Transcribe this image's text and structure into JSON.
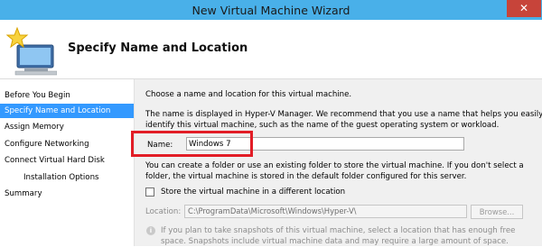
{
  "window": {
    "title": "New Virtual Machine Wizard",
    "close_label": "✕"
  },
  "header": {
    "heading": "Specify Name and Location",
    "icon": "computer-star-icon"
  },
  "sidebar": {
    "items": [
      {
        "label": "Before You Begin"
      },
      {
        "label": "Specify Name and Location"
      },
      {
        "label": "Assign Memory"
      },
      {
        "label": "Configure Networking"
      },
      {
        "label": "Connect Virtual Hard Disk"
      },
      {
        "label": "Installation Options"
      },
      {
        "label": "Summary"
      }
    ],
    "selected_index": 1
  },
  "main": {
    "intro": "Choose a name and location for this virtual machine.",
    "description_line1": "The name is displayed in Hyper-V Manager. We recommend that you use a name that helps you easily",
    "description_line2": "identify this virtual machine, such as the name of the guest operating system or workload.",
    "name_label": "Name:",
    "name_value": "Windows 7",
    "folder_line1": "You can create a folder or use an existing folder to store the virtual machine. If you don't select a",
    "folder_line2": "folder, the virtual machine is stored in the default folder configured for this server.",
    "store_checkbox_label": "Store the virtual machine in a different location",
    "store_checked": false,
    "location_label": "Location:",
    "location_value": "C:\\ProgramData\\Microsoft\\Windows\\Hyper-V\\",
    "browse_label": "Browse...",
    "info_line1": "If you plan to take snapshots of this virtual machine, select a location that has enough free",
    "info_line2": "space. Snapshots include virtual machine data and may require a large amount of space."
  },
  "colors": {
    "titlebar": "#49b0e9",
    "selection": "#3399ff",
    "highlight": "#e21d26",
    "close": "#c7443a"
  }
}
